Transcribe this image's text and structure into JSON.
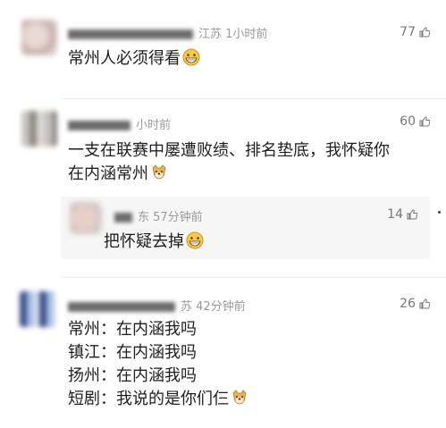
{
  "comments": [
    {
      "location_time": "江苏 1小时前",
      "likes": "77",
      "text": "常州人必须得看"
    },
    {
      "location_time": "小时前",
      "likes": "60",
      "text_line1": "一支在联赛中屡遭败绩、排名垫底，我怀疑你",
      "text_line2": "在内涵常州"
    },
    {
      "location_time": "东 57分钟前",
      "likes": "14",
      "text": "把怀疑去掉"
    },
    {
      "location_time": "苏 42分钟前",
      "likes": "26",
      "lines": [
        "常州：在内涵我吗",
        "镇江：在内涵我吗",
        "扬州：在内涵我吗",
        "短剧：我说的是你们仨"
      ]
    }
  ],
  "icons": {
    "like": "thumb-up-icon",
    "grin": "grinning-emoji-icon",
    "doge": "doge-emoji-icon"
  }
}
